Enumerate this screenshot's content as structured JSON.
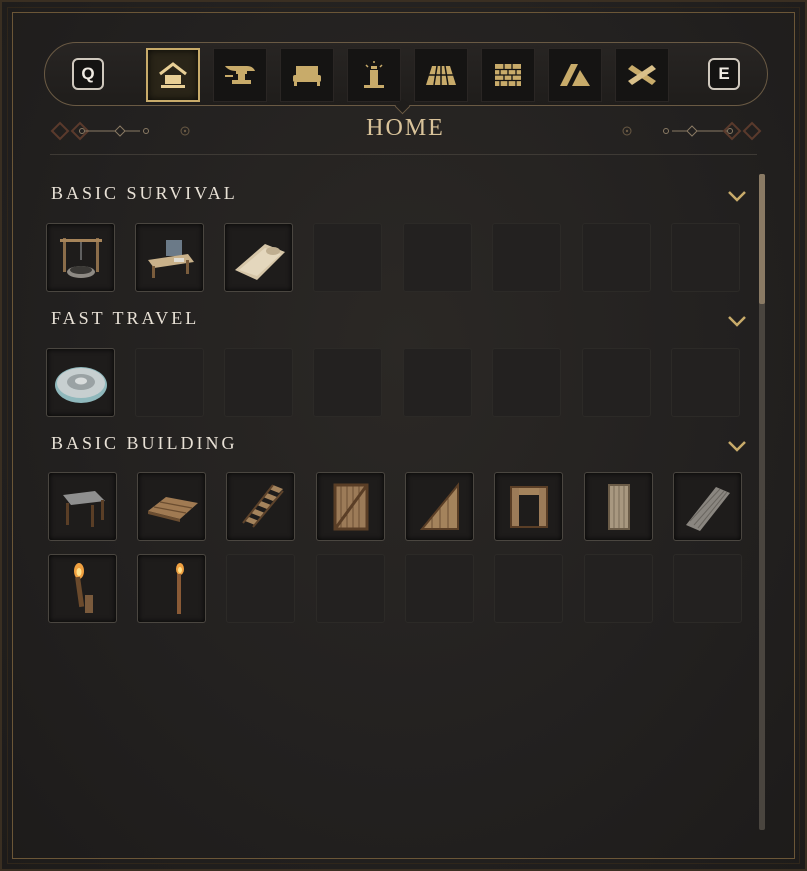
{
  "toolbar": {
    "left_key": "Q",
    "right_key": "E",
    "tabs": [
      {
        "icon": "home-icon",
        "active": true
      },
      {
        "icon": "anvil-icon",
        "active": false
      },
      {
        "icon": "bed-icon",
        "active": false
      },
      {
        "icon": "lighthouse-icon",
        "active": false
      },
      {
        "icon": "floor-tiles-icon",
        "active": false
      },
      {
        "icon": "brick-wall-icon",
        "active": false
      },
      {
        "icon": "roof-icon",
        "active": false
      },
      {
        "icon": "crossed-planks-icon",
        "active": false
      }
    ]
  },
  "page_title": "HOME",
  "colors": {
    "accent_gold": "#c8ab6a",
    "title_gold": "#d9c39a",
    "text": "#e8e1d6",
    "slot_bg": "#232120"
  },
  "sections": [
    {
      "title": "BASIC SURVIVAL",
      "items": [
        "well-icon",
        "workbench-icon",
        "bedroll-icon"
      ]
    },
    {
      "title": "FAST TRAVEL",
      "items": [
        "waystone-icon"
      ]
    },
    {
      "title": "BASIC BUILDING",
      "items": [
        "table-icon",
        "wood-floor-icon",
        "stairs-icon",
        "wall-frame-icon",
        "triangle-wall-icon",
        "doorway-icon",
        "door-icon",
        "ramp-icon",
        "wall-torch-icon",
        "standing-torch-icon"
      ]
    }
  ]
}
